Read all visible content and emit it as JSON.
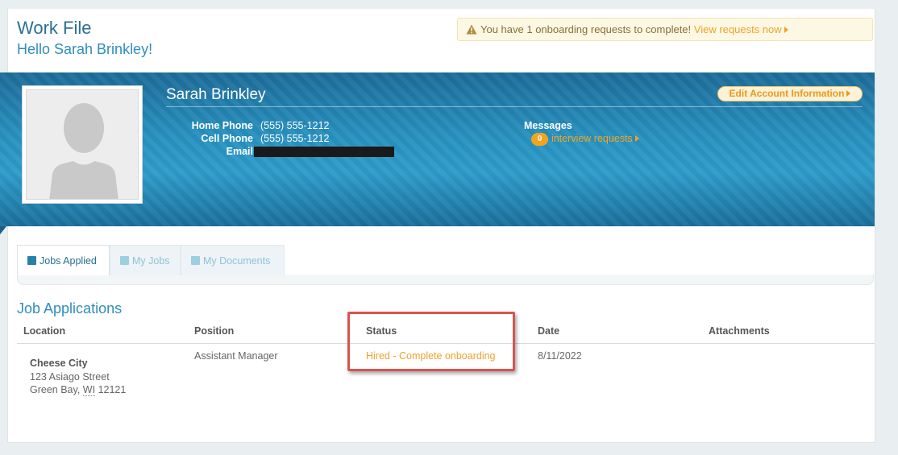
{
  "header": {
    "title": "Work File",
    "greeting": "Hello Sarah Brinkley!"
  },
  "alert": {
    "message": "You have 1 onboarding requests to complete!",
    "link_label": "View requests now"
  },
  "profile": {
    "name": "Sarah Brinkley",
    "edit_button": "Edit Account Information",
    "home_phone_label": "Home Phone",
    "home_phone": "(555) 555-1212",
    "cell_phone_label": "Cell Phone",
    "cell_phone": "(555) 555-1212",
    "email_label": "Email",
    "messages_label": "Messages",
    "interview_count": "0",
    "interview_link": "interview requests"
  },
  "tabs": [
    {
      "label": "Jobs Applied",
      "active": true
    },
    {
      "label": "My Jobs",
      "active": false
    },
    {
      "label": "My Documents",
      "active": false
    }
  ],
  "applications": {
    "title": "Job Applications",
    "columns": [
      "Location",
      "Position",
      "Status",
      "Date",
      "Attachments"
    ],
    "rows": [
      {
        "location_name": "Cheese City",
        "location_street": "123 Asiago Street",
        "location_city": "Green Bay,",
        "location_state": "WI",
        "location_zip": "12121",
        "position": "Assistant Manager",
        "status": "Hired - Complete onboarding",
        "date": "8/11/2022",
        "attachments": ""
      }
    ]
  },
  "colors": {
    "brand_blue": "#2a6f96",
    "accent_orange": "#f0a12c",
    "highlight_red": "#d9534f"
  }
}
